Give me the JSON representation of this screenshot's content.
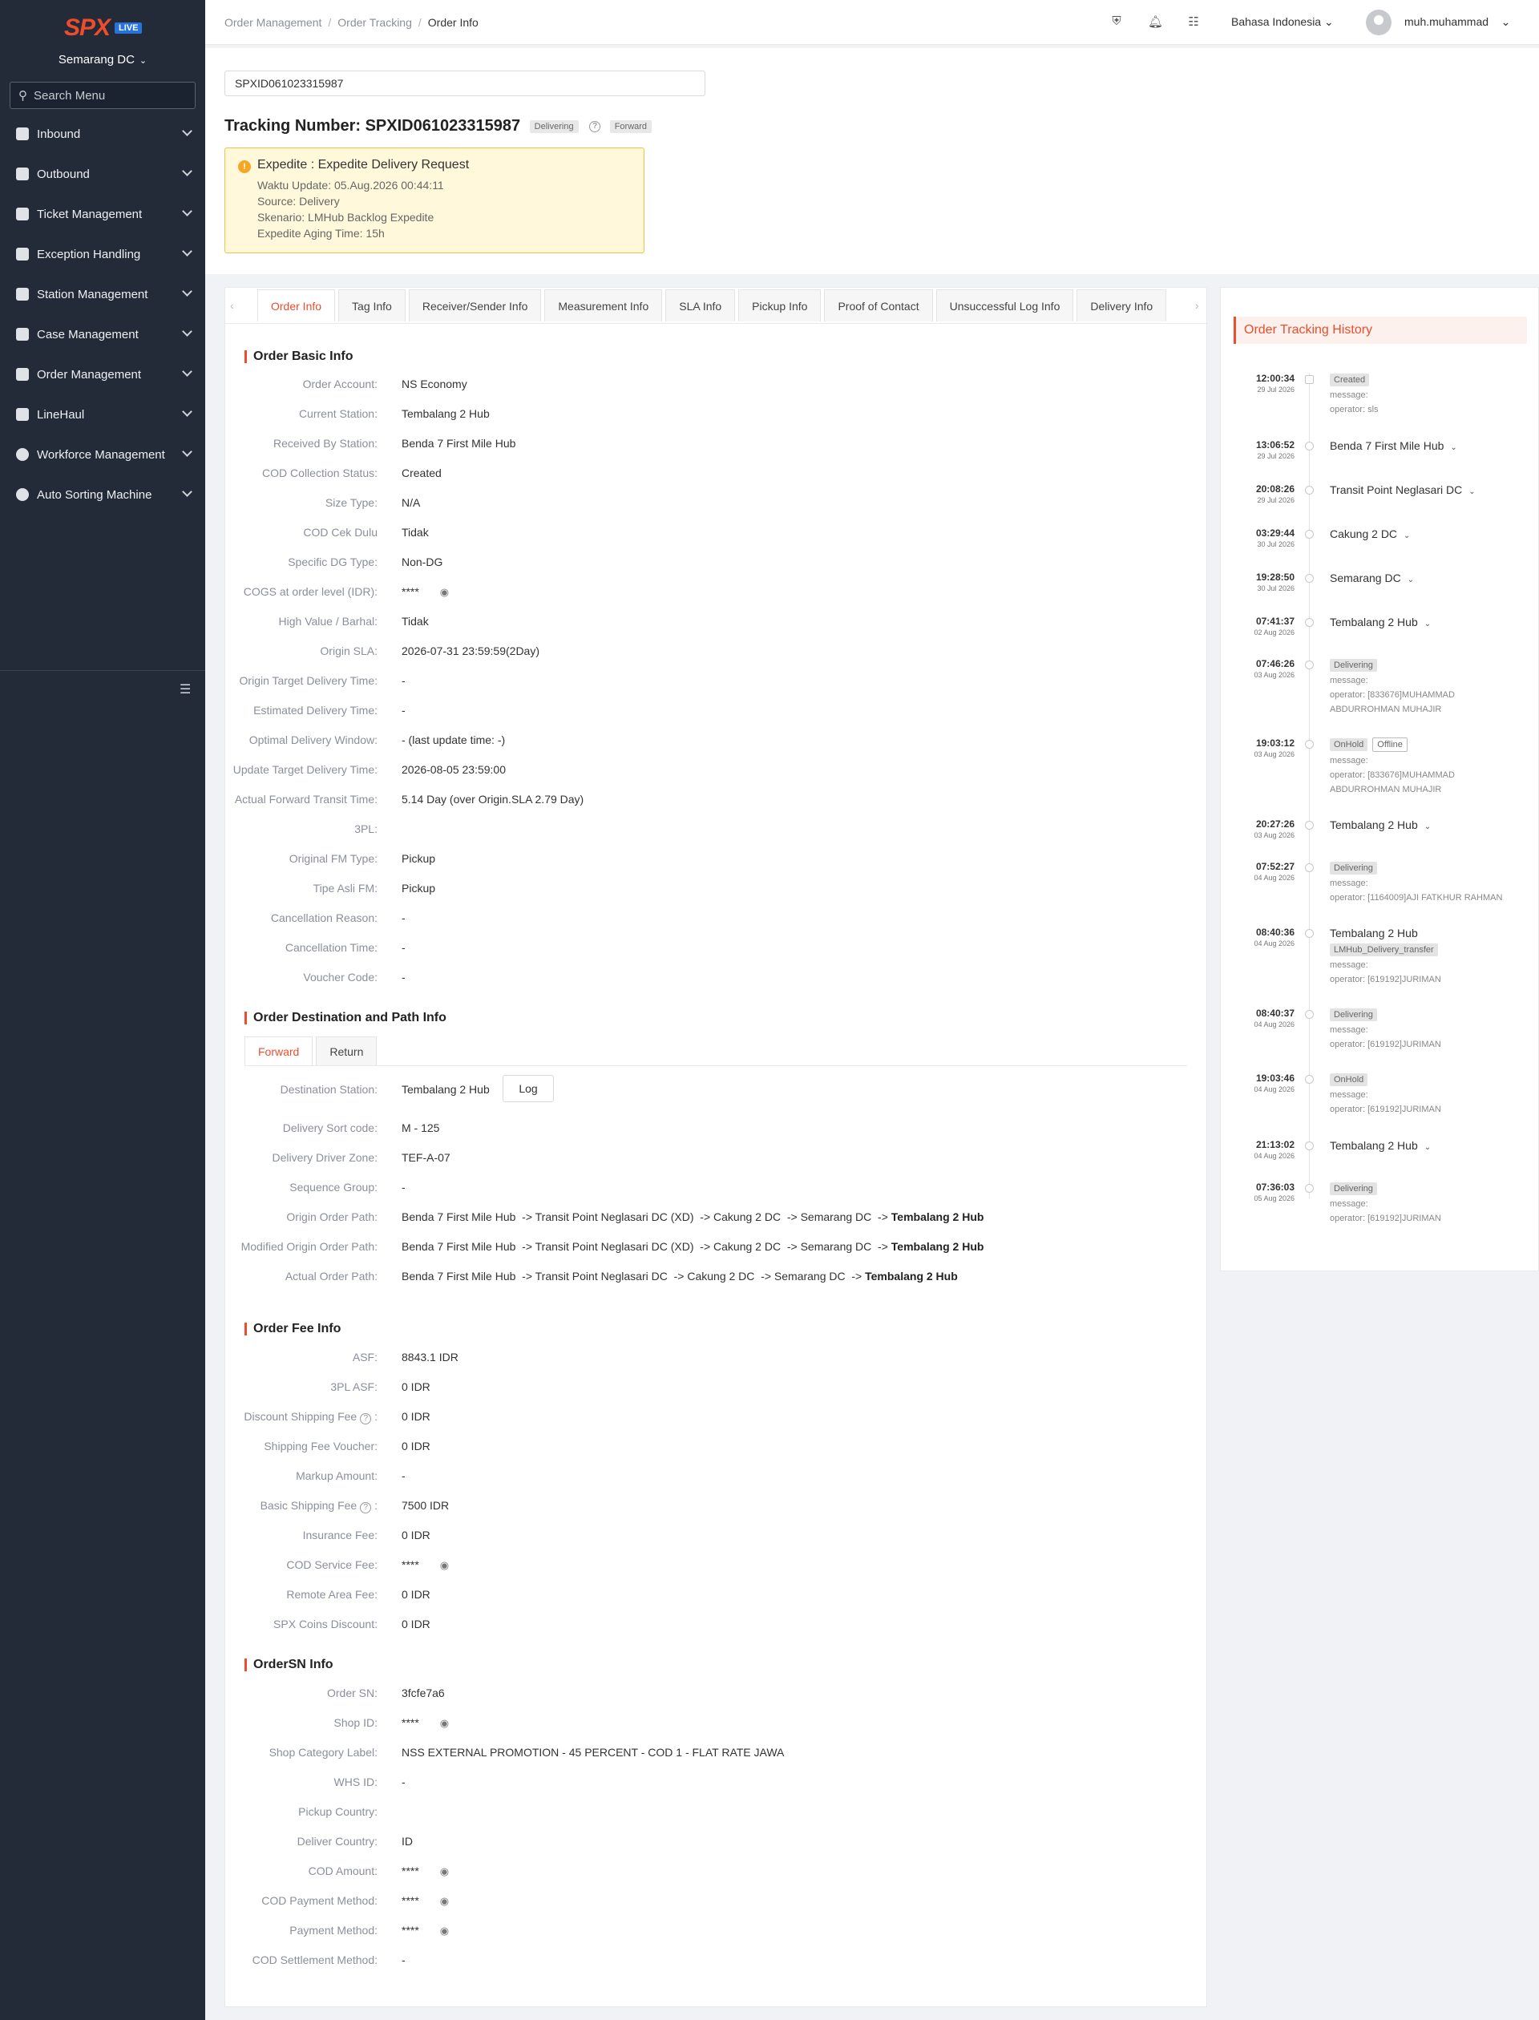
{
  "app": {
    "logo_text": "SPX",
    "live_badge": "LIVE",
    "station": "Semarang DC",
    "search_placeholder": "Search Menu"
  },
  "sidebar": {
    "items": [
      {
        "label": "Inbound",
        "icon": "check-square-icon"
      },
      {
        "label": "Outbound",
        "icon": "calendar-icon"
      },
      {
        "label": "Ticket Management",
        "icon": "book-icon"
      },
      {
        "label": "Exception Handling",
        "icon": "alert-icon"
      },
      {
        "label": "Station Management",
        "icon": "home-icon"
      },
      {
        "label": "Case Management",
        "icon": "briefcase-icon"
      },
      {
        "label": "Order Management",
        "icon": "box-icon"
      },
      {
        "label": "LineHaul",
        "icon": "truck-icon"
      },
      {
        "label": "Workforce Management",
        "icon": "user-icon"
      },
      {
        "label": "Auto Sorting Machine",
        "icon": "gear-icon"
      }
    ]
  },
  "topbar": {
    "breadcrumb": [
      "Order Management",
      "Order Tracking",
      "Order Info"
    ],
    "language": "Bahasa Indonesia",
    "user": "muh.muhammad"
  },
  "header": {
    "search_value": "SPXID061023315987",
    "title": "Tracking Number: SPXID061023315987",
    "status_badge": "Delivering",
    "direction_badge": "Forward",
    "alert": {
      "title": "Expedite : Expedite Delivery Request",
      "lines": [
        "Waktu Update: 05.Aug.2026 00:44:11",
        "Source: Delivery",
        "Skenario: LMHub Backlog Expedite",
        "Expedite Aging Time: 15h"
      ]
    }
  },
  "tabs": [
    "Order Info",
    "Tag Info",
    "Receiver/Sender Info",
    "Measurement Info",
    "SLA Info",
    "Pickup Info",
    "Proof of Contact",
    "Unsuccessful Log Info",
    "Delivery Info"
  ],
  "basic_info": {
    "title": "Order Basic Info",
    "fields": [
      {
        "label": "Order Account:",
        "value": "NS Economy"
      },
      {
        "label": "Current Station:",
        "value": "Tembalang 2 Hub"
      },
      {
        "label": "Received By Station:",
        "value": "Benda 7 First Mile Hub"
      },
      {
        "label": "COD Collection Status:",
        "value": "Created"
      },
      {
        "label": "Size Type:",
        "value": "N/A"
      },
      {
        "label": "COD Cek Dulu",
        "value": "Tidak"
      },
      {
        "label": "Specific DG Type:",
        "value": "Non-DG"
      },
      {
        "label": "COGS at order level (IDR):",
        "value": "****"
      },
      {
        "label": "High Value / Barhal:",
        "value": "Tidak"
      },
      {
        "label": "Origin SLA:",
        "value": "2026-07-31 23:59:59(2Day)"
      },
      {
        "label": "Origin Target Delivery Time:",
        "value": "-"
      },
      {
        "label": "Estimated Delivery Time:",
        "value": "-"
      },
      {
        "label": "Optimal Delivery Window:",
        "value": "- (last update time: -)"
      },
      {
        "label": "Update Target Delivery Time:",
        "value": "2026-08-05 23:59:00"
      },
      {
        "label": "Actual Forward Transit Time:",
        "value": "5.14 Day (over Origin.SLA 2.79 Day)"
      },
      {
        "label": "3PL:",
        "value": ""
      },
      {
        "label": "Original FM Type:",
        "value": "Pickup"
      },
      {
        "label": "Tipe Asli FM:",
        "value": "Pickup"
      },
      {
        "label": "Cancellation Reason:",
        "value": "-"
      },
      {
        "label": "Cancellation Time:",
        "value": "-"
      },
      {
        "label": "Voucher Code:",
        "value": "-"
      }
    ]
  },
  "destination_info": {
    "title": "Order Destination and Path Info",
    "sub_tabs": [
      "Forward",
      "Return"
    ],
    "log_button": "Log",
    "fields": [
      {
        "label": "Destination Station:",
        "value": "Tembalang 2 Hub"
      },
      {
        "label": "Delivery Sort code:",
        "value": "M - 125"
      },
      {
        "label": "Delivery Driver Zone:",
        "value": "TEF-A-07"
      },
      {
        "label": "Sequence Group:",
        "value": "-"
      }
    ],
    "paths": [
      {
        "label": "Origin Order Path:",
        "value": "Benda 7 First Mile Hub  -> Transit Point Neglasari DC (XD)  -> Cakung 2 DC  -> Semarang DC  -> ",
        "end": "Tembalang 2 Hub"
      },
      {
        "label": "Modified Origin Order Path:",
        "value": "Benda 7 First Mile Hub  -> Transit Point Neglasari DC (XD)  -> Cakung 2 DC  -> Semarang DC  -> ",
        "end": "Tembalang 2 Hub"
      },
      {
        "label": "Actual Order Path:",
        "value": "Benda 7 First Mile Hub  -> Transit Point Neglasari DC  -> Cakung 2 DC  -> Semarang DC  -> ",
        "end": "Tembalang 2 Hub"
      }
    ]
  },
  "fee_info": {
    "title": "Order Fee Info",
    "fields": [
      {
        "label": "ASF:",
        "value": "8843.1 IDR"
      },
      {
        "label": "3PL ASF:",
        "value": "0 IDR"
      },
      {
        "label": "Discount Shipping Fee",
        "value": "0 IDR"
      },
      {
        "label": "Shipping Fee Voucher:",
        "value": "0 IDR"
      },
      {
        "label": "Markup Amount:",
        "value": "-"
      },
      {
        "label": "Basic Shipping Fee",
        "value": "7500 IDR"
      },
      {
        "label": "Insurance Fee:",
        "value": "0 IDR"
      },
      {
        "label": "COD Service Fee:",
        "value": "****"
      },
      {
        "label": "Remote Area Fee:",
        "value": "0 IDR"
      },
      {
        "label": "SPX Coins Discount:",
        "value": "0 IDR"
      }
    ]
  },
  "ordersn_info": {
    "title": "OrderSN Info",
    "fields": [
      {
        "label": "Order SN:",
        "value": "3fcfe7a6"
      },
      {
        "label": "Shop ID:",
        "value": "****"
      },
      {
        "label": "Shop Category Label:",
        "value": "NSS EXTERNAL PROMOTION - 45 PERCENT - COD 1 - FLAT RATE JAWA"
      },
      {
        "label": "WHS ID:",
        "value": "-"
      },
      {
        "label": "Pickup Country:",
        "value": ""
      },
      {
        "label": "Deliver Country:",
        "value": "ID"
      },
      {
        "label": "COD Amount:",
        "value": "****"
      },
      {
        "label": "COD Payment Method:",
        "value": "****"
      },
      {
        "label": "Payment Method:",
        "value": "****"
      },
      {
        "label": "COD Settlement Method:",
        "value": "-"
      }
    ]
  },
  "history": {
    "title": "Order Tracking History",
    "events": [
      {
        "time": "12:00:34",
        "date": "29 Jul 2026",
        "tag": "Created",
        "lines": [
          "message:",
          "operator: sls"
        ]
      },
      {
        "time": "13:06:52",
        "date": "29 Jul 2026",
        "station": "Benda 7 First Mile Hub"
      },
      {
        "time": "20:08:26",
        "date": "29 Jul 2026",
        "station": "Transit Point Neglasari DC"
      },
      {
        "time": "03:29:44",
        "date": "30 Jul 2026",
        "station": "Cakung 2 DC"
      },
      {
        "time": "19:28:50",
        "date": "30 Jul 2026",
        "station": "Semarang DC"
      },
      {
        "time": "07:41:37",
        "date": "02 Aug 2026",
        "station": "Tembalang 2 Hub"
      },
      {
        "time": "07:46:26",
        "date": "03 Aug 2026",
        "tag": "Delivering",
        "lines": [
          "message:",
          "operator: [833676]MUHAMMAD",
          "ABDURROHMAN MUHAJIR"
        ]
      },
      {
        "time": "19:03:12",
        "date": "03 Aug 2026",
        "tag": "OnHold",
        "tag2": "Offline",
        "lines": [
          "message:",
          "operator: [833676]MUHAMMAD",
          "ABDURROHMAN MUHAJIR"
        ]
      },
      {
        "time": "20:27:26",
        "date": "03 Aug 2026",
        "station": "Tembalang 2 Hub"
      },
      {
        "time": "07:52:27",
        "date": "04 Aug 2026",
        "tag": "Delivering",
        "lines": [
          "message:",
          "operator: [1164009]AJI FATKHUR RAHMAN"
        ]
      },
      {
        "time": "08:40:36",
        "date": "04 Aug 2026",
        "station_plain": "Tembalang 2 Hub",
        "tag": "LMHub_Delivery_transfer",
        "lines": [
          "message:",
          "operator: [619192]JURIMAN"
        ]
      },
      {
        "time": "08:40:37",
        "date": "04 Aug 2026",
        "tag": "Delivering",
        "lines": [
          "message:",
          "operator: [619192]JURIMAN"
        ]
      },
      {
        "time": "19:03:46",
        "date": "04 Aug 2026",
        "tag": "OnHold",
        "lines": [
          "message:",
          "operator: [619192]JURIMAN"
        ]
      },
      {
        "time": "21:13:02",
        "date": "04 Aug 2026",
        "station": "Tembalang 2 Hub"
      },
      {
        "time": "07:36:03",
        "date": "05 Aug 2026",
        "tag": "Delivering",
        "lines": [
          "message:",
          "operator: [619192]JURIMAN"
        ]
      }
    ]
  }
}
